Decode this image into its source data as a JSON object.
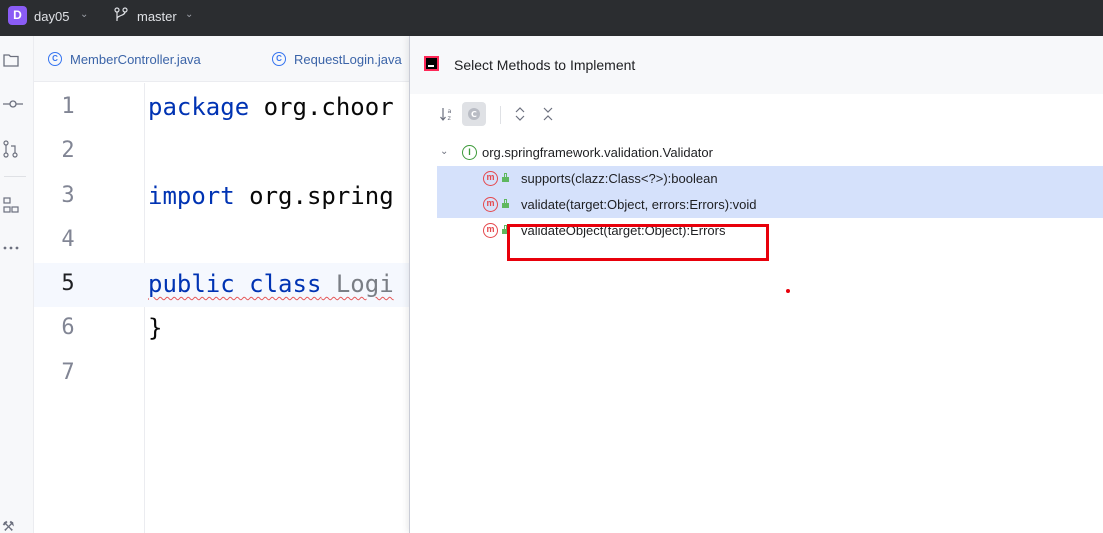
{
  "titlebar": {
    "project_badge": "D",
    "project_name": "day05",
    "branch_name": "master"
  },
  "editor_tabs": [
    {
      "label": "MemberController.java"
    },
    {
      "label": "RequestLogin.java"
    }
  ],
  "editor": {
    "lines": [
      {
        "num": "1",
        "kw": "package",
        "rest": " org.choor"
      },
      {
        "num": "2",
        "kw": "",
        "rest": ""
      },
      {
        "num": "3",
        "kw": "import",
        "rest": " org.spring"
      },
      {
        "num": "4",
        "kw": "",
        "rest": ""
      },
      {
        "num": "5",
        "kw": "public class",
        "rest": " Logi"
      },
      {
        "num": "6",
        "kw": "",
        "rest": "}"
      },
      {
        "num": "7",
        "kw": "",
        "rest": ""
      }
    ]
  },
  "popup": {
    "title": "Select Methods to Implement",
    "interface": "org.springframework.validation.Validator",
    "methods": [
      {
        "label": "supports(clazz:Class<?>):boolean",
        "selected": true
      },
      {
        "label": "validate(target:Object, errors:Errors):void",
        "selected": true
      },
      {
        "label": "validateObject(target:Object):Errors",
        "selected": false
      }
    ]
  },
  "icons": {
    "sort": "sort-alpha-icon",
    "show_classes": "show-classes-icon",
    "expand_all": "expand-all-icon",
    "collapse_all": "collapse-all-icon"
  },
  "colors": {
    "selection": "#d5e1fb",
    "annotation": "#e8000b",
    "keyword": "#0033b3"
  }
}
